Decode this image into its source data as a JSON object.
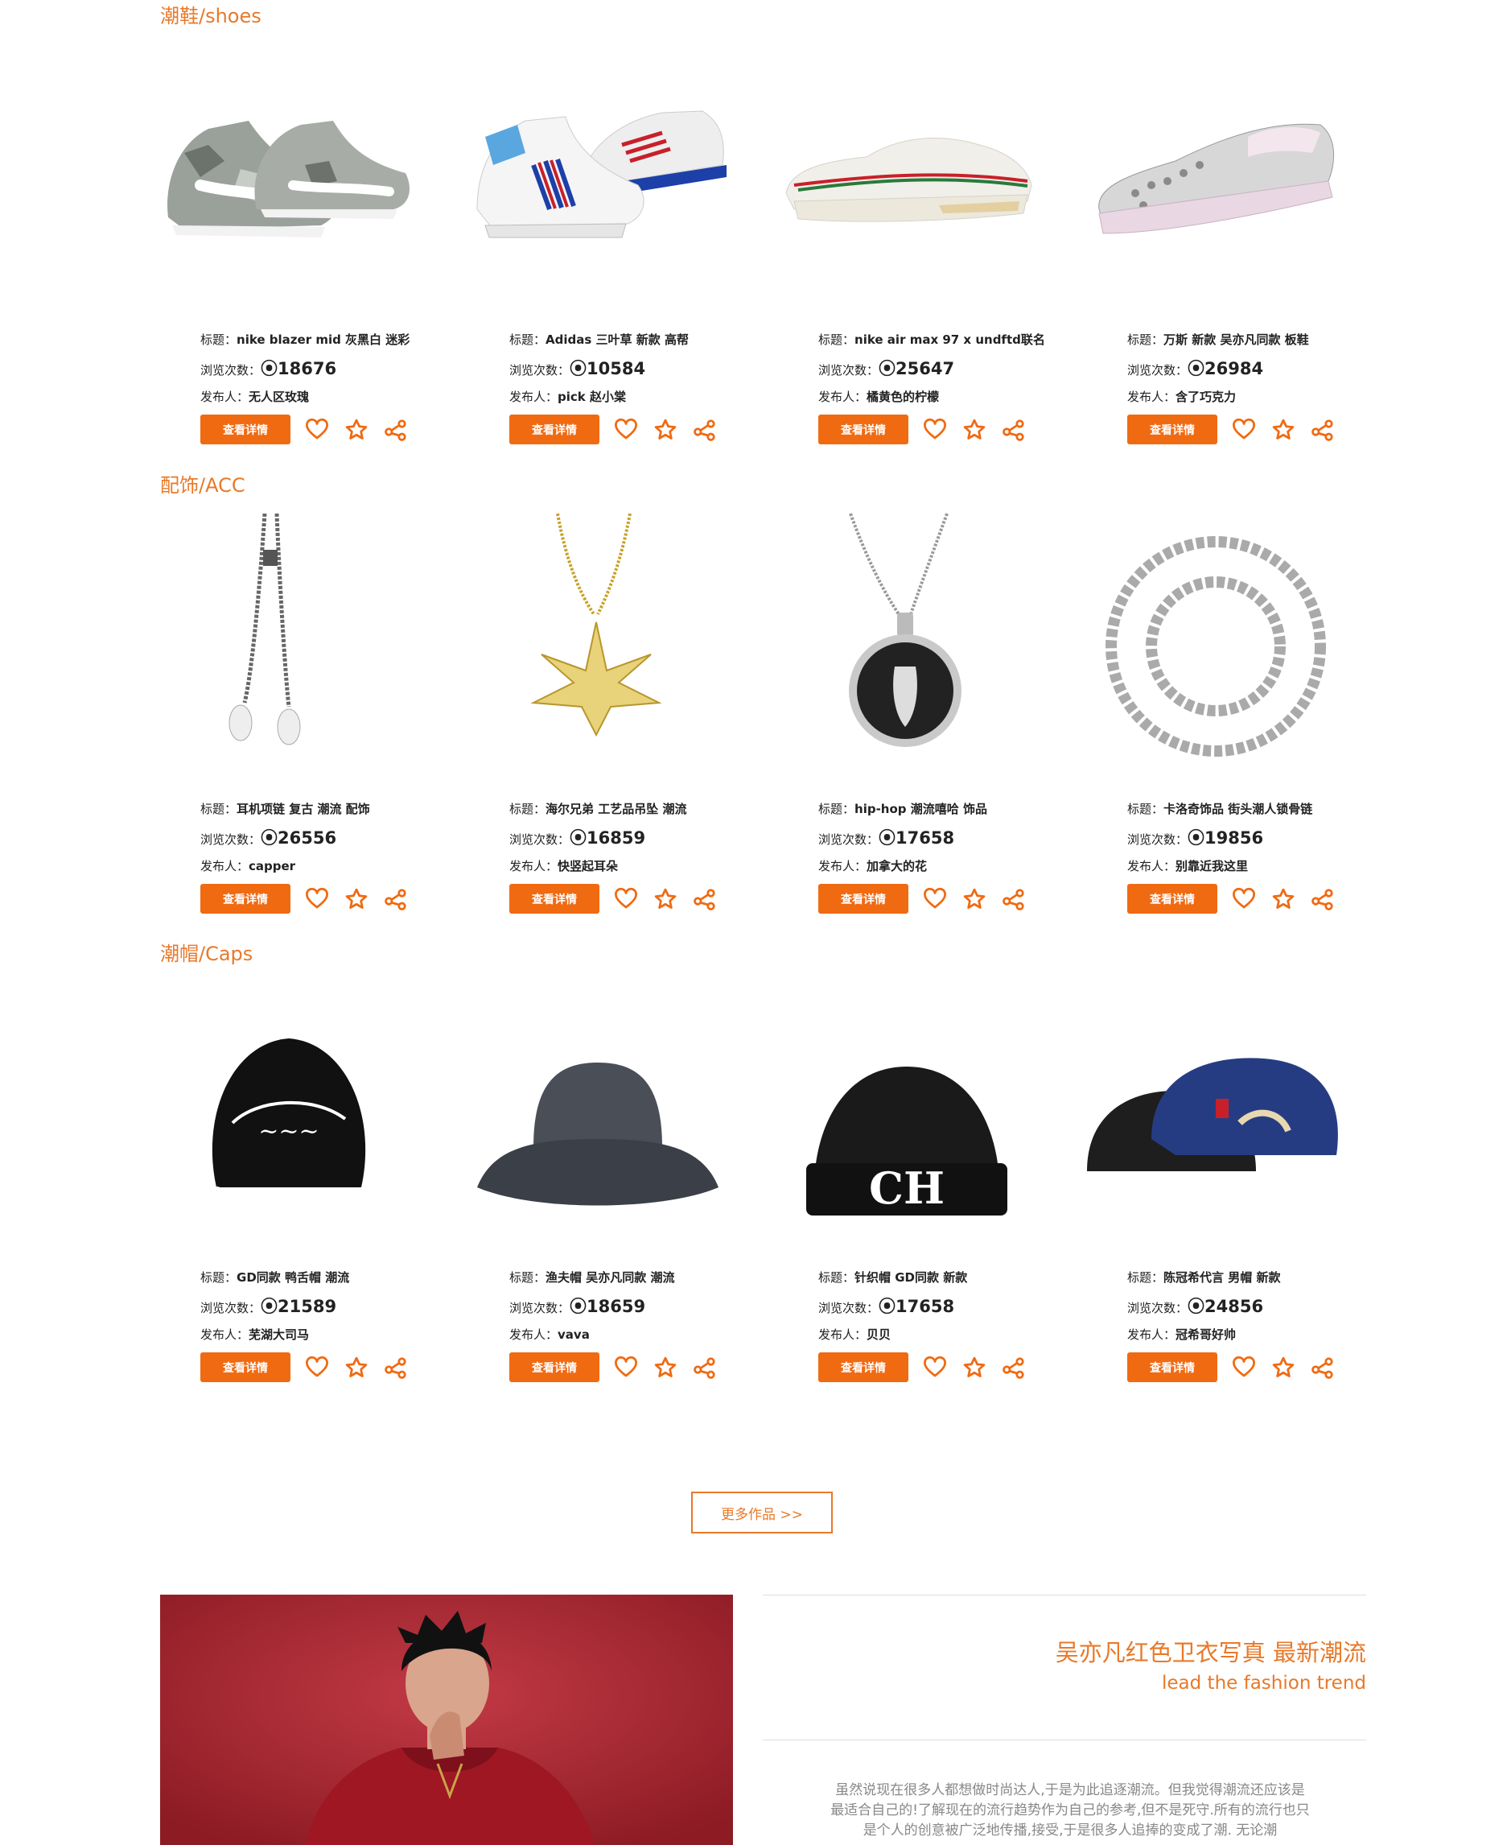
{
  "colors": {
    "accent": "#f06a12",
    "title": "#e8792a"
  },
  "icons": [
    "heart-icon",
    "star-icon",
    "share-icon"
  ],
  "labels": {
    "title_prefix": "标题：",
    "views_prefix": "浏览次数：",
    "publisher_prefix": "发布人：",
    "detail_button": "查看详情"
  },
  "sections": [
    {
      "title": "潮鞋/shoes",
      "items": [
        {
          "title": "nike blazer mid 灰黑白 迷彩",
          "views": "⦿18676",
          "publisher": "无人区玫瑰",
          "image": "sneaker-camo"
        },
        {
          "title": "Adidas 三叶草 新款 高帮",
          "views": "⦿10584",
          "publisher": "pick 赵小棠",
          "image": "sneaker-adidas"
        },
        {
          "title": "nike air max 97 x undftd联名",
          "views": "⦿25647",
          "publisher": "橘黄色的柠檬",
          "image": "sneaker-airmax"
        },
        {
          "title": "万斯 新款 吴亦凡同款 板鞋",
          "views": "⦿26984",
          "publisher": "含了巧克力",
          "image": "sneaker-vans"
        }
      ]
    },
    {
      "title": "配饰/ACC",
      "items": [
        {
          "title": "耳机项链 复古 潮流 配饰",
          "views": "⦿26556",
          "publisher": "capper",
          "image": "earphone-necklace"
        },
        {
          "title": "海尔兄弟 工艺品吊坠 潮流",
          "views": "⦿16859",
          "publisher": "快竖起耳朵",
          "image": "leaf-pendant"
        },
        {
          "title": "hip-hop 潮流嘻哈 饰品",
          "views": "⦿17658",
          "publisher": "加拿大的花",
          "image": "coin-pendant"
        },
        {
          "title": "卡洛奇饰品 街头潮人锁骨链",
          "views": "⦿19856",
          "publisher": "别靠近我这里",
          "image": "cuban-chain"
        }
      ]
    },
    {
      "title": "潮帽/Caps",
      "items": [
        {
          "title": "GD同款 鸭舌帽 潮流",
          "views": "⦿21589",
          "publisher": "芜湖大司马",
          "image": "baseball-cap"
        },
        {
          "title": "渔夫帽 吴亦凡同款 潮流",
          "views": "⦿18659",
          "publisher": "vava",
          "image": "bucket-hat"
        },
        {
          "title": "针织帽 GD同款 新款",
          "views": "⦿17658",
          "publisher": "贝贝",
          "image": "beanie"
        },
        {
          "title": "陈冠希代言 男帽 新款",
          "views": "⦿24856",
          "publisher": "冠希哥好帅",
          "image": "docker-cap"
        }
      ]
    }
  ],
  "more_button": "更多作品 >>",
  "feature": {
    "title": "吴亦凡红色卫衣写真 最新潮流",
    "subtitle": "lead the fashion trend",
    "text": "虽然说现在很多人都想做时尚达人,于是为此追逐潮流。但我觉得潮流还应该是最适合自己的!了解现在的流行趋势作为自己的参考,但不是死守.所有的流行也只是个人的创意被广泛地传播,接受,于是很多人追捧的变成了潮. 无论潮"
  }
}
